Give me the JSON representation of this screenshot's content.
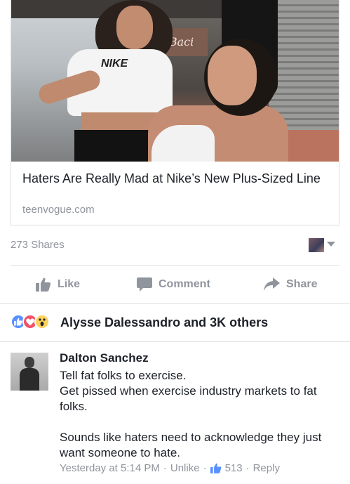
{
  "link_card": {
    "title": "Haters Are Really Mad at Nike’s New Plus-Sized Line",
    "domain": "teenvogue.com",
    "image_sign_text": "Baci",
    "image_logo_text": "NIKE"
  },
  "post_stats": {
    "shares": "273 Shares"
  },
  "actions": {
    "like": "Like",
    "comment": "Comment",
    "share": "Share"
  },
  "reactions": {
    "icons": [
      "like-reaction-icon",
      "love-reaction-icon",
      "wow-reaction-icon"
    ],
    "summary": "Alysse Dalessandro and 3K others"
  },
  "comment": {
    "author": "Dalton Sanchez",
    "lines": [
      "Tell fat folks to exercise.",
      "Get pissed when exercise industry markets to fat folks.",
      "",
      "Sounds like haters need to acknowledge they just want someone to hate."
    ],
    "time": "Yesterday at 5:14 PM",
    "unlike": "Unlike",
    "like_count": "513",
    "reply": "Reply",
    "separator": "·"
  },
  "colors": {
    "text_primary": "#1d2129",
    "text_secondary": "#90949c",
    "divider": "#dddfe2",
    "like_blue": "#5890ff",
    "love_red": "#f25268",
    "wow_yellow": "#fcd15c"
  }
}
